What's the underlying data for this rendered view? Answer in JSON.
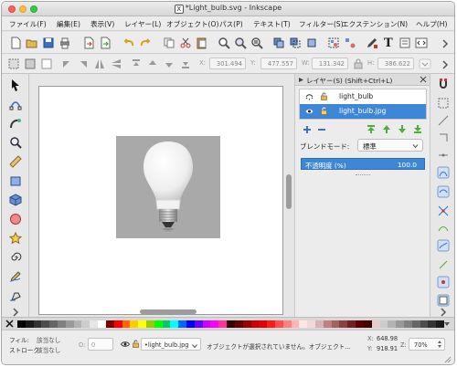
{
  "window": {
    "title": "*Light_bulb.svg - Inkscape",
    "traffic_lights": {
      "close": "#fc605c",
      "minimize": "#fdbc40",
      "zoom": "#34c84a"
    }
  },
  "menu": [
    "ファイル(F)",
    "編集(E)",
    "表示(V)",
    "レイヤー(L)",
    "オブジェクト(O)",
    "パス(P)",
    "テキスト(T)",
    "フィルター(S)",
    "エクステンション(N)",
    "ヘルプ(H)"
  ],
  "command_icons": [
    "new-document-icon",
    "open-icon",
    "save-icon",
    "print-icon",
    "import-icon",
    "export-icon",
    "undo-icon",
    "redo-icon",
    "copy-icon",
    "cut-icon",
    "paste-icon",
    "zoom-selection-icon",
    "zoom-drawing-icon",
    "zoom-page-icon",
    "duplicate-icon",
    "clone-icon",
    "unlink-clone-icon",
    "group-icon",
    "ungroup-icon",
    "fill-stroke-icon",
    "text-font-icon",
    "layers-icon",
    "align-icon",
    "xml-editor-icon"
  ],
  "tool_controls": {
    "x_label": "X:",
    "x_value": "301.494",
    "y_label": "Y:",
    "y_value": "477.557",
    "w_label": "W:",
    "w_value": "131.342",
    "h_label": "H:",
    "h_value": "386.622"
  },
  "tools": [
    "selector-arrow-icon",
    "node-tool-icon",
    "tweak-tool-icon",
    "zoom-tool-icon",
    "measure-tool-icon",
    "rectangle-tool-icon",
    "3d-box-tool-icon",
    "ellipse-tool-icon",
    "star-tool-icon",
    "spiral-tool-icon",
    "pencil-tool-icon",
    "pen-tool-icon"
  ],
  "layers_panel": {
    "title": "レイヤー(S) (Shift+Ctrl+L)",
    "layers": [
      {
        "name": "light_bulb",
        "visible": false,
        "locked": false,
        "selected": false
      },
      {
        "name": "light_bulb.jpg",
        "visible": true,
        "locked": false,
        "selected": true
      }
    ],
    "blend_label": "ブレンドモード:",
    "blend_value": "標準",
    "opacity_label": "不透明度 (%)",
    "opacity_value": "100.0"
  },
  "canvas": {
    "image_name": "light_bulb.jpg",
    "photo_background": "#a9a9a9"
  },
  "palette": {
    "colors": [
      "#000000",
      "#1a1a1a",
      "#333333",
      "#4d4d4d",
      "#666666",
      "#808080",
      "#999999",
      "#b3b3b3",
      "#cccccc",
      "#e6e6e6",
      "#ffffff",
      "#800000",
      "#ff0000",
      "#ff6600",
      "#ffcc00",
      "#ffff00",
      "#99cc00",
      "#00ff00",
      "#00cc66",
      "#00ffff",
      "#0066ff",
      "#0000ff",
      "#6600ff",
      "#cc00ff",
      "#ff00ff",
      "#ff3399",
      "#330000",
      "#660000",
      "#990000",
      "#cc0000",
      "#e60000",
      "#ff1a1a",
      "#ff4d4d",
      "#ff8080",
      "#ffb3b3",
      "#ffe6e6",
      "#f2d9d9",
      "#d9b3b3",
      "#c08080",
      "#a66060",
      "#8c4040",
      "#732020",
      "#590000",
      "#400000",
      "#e6cccc",
      "#cccccc",
      "#b3b3b3",
      "#999999",
      "#808080",
      "#666666",
      "#4d4d4d",
      "#333333",
      "#1a1a1a"
    ]
  },
  "status": {
    "fill_label": "フィル:",
    "fill_value": "該当なし",
    "stroke_label": "ストローク:",
    "stroke_value": "該当なし",
    "opacity_short": "O:",
    "opacity_value": "0",
    "layer_select": "•light_bulb.jpg",
    "message": "オブジェクトが選択されていません。オブジェクト...",
    "cursor_x_label": "X:",
    "cursor_x": "648.98",
    "cursor_y_label": "Y:",
    "cursor_y": "918.91",
    "zoom_label": "Z:",
    "zoom_value": "70%"
  }
}
